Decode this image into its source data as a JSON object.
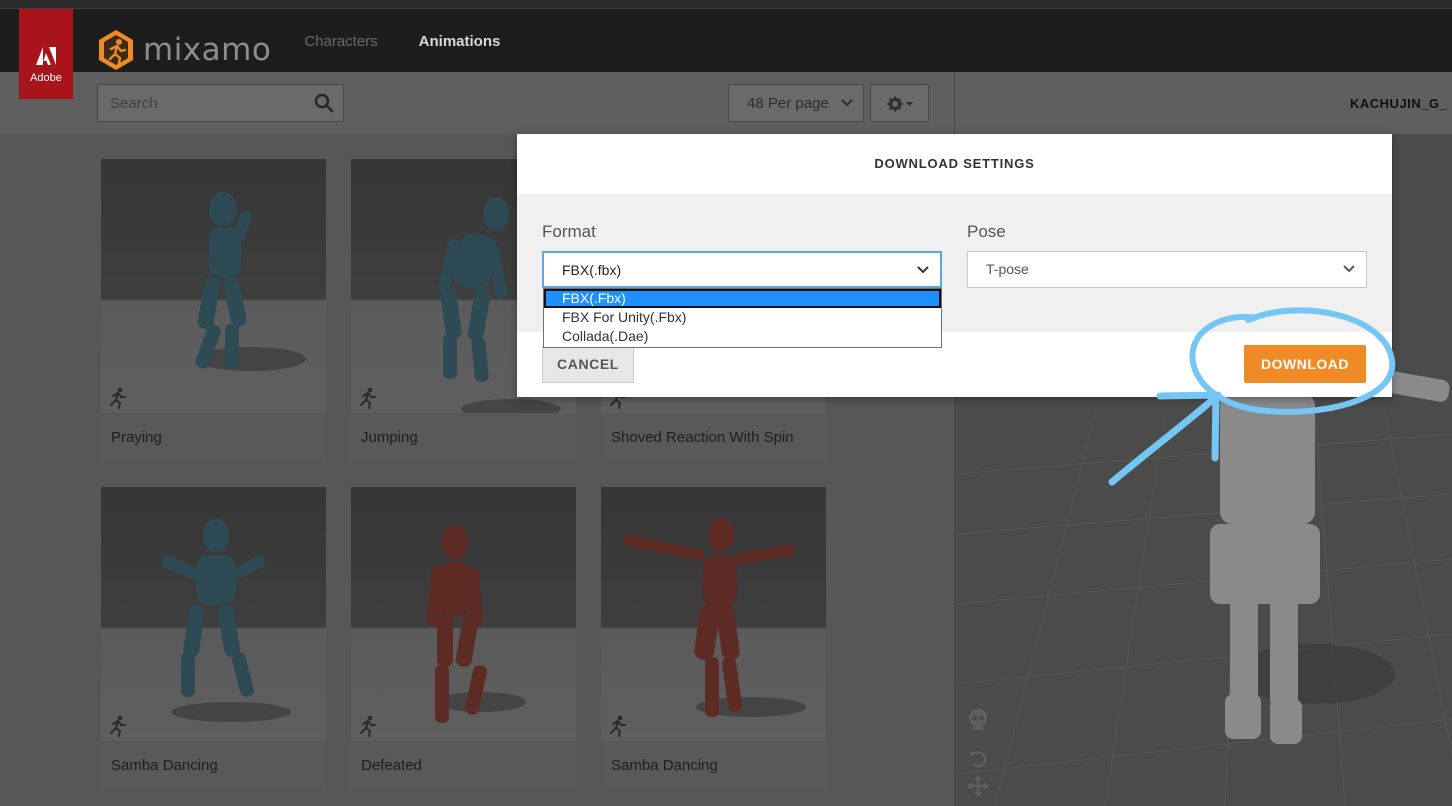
{
  "header": {
    "adobe_label": "Adobe",
    "brand": "mixamo",
    "tabs": [
      {
        "label": "Characters",
        "active": false
      },
      {
        "label": "Animations",
        "active": true
      }
    ],
    "accent_color": "#f08a24"
  },
  "toolbar": {
    "search_placeholder": "Search",
    "per_page": "48 Per page"
  },
  "viewer": {
    "title": "KACHUJIN_G_"
  },
  "cards": [
    {
      "caption": "Praying"
    },
    {
      "caption": "Jumping"
    },
    {
      "caption": "Shoved Reaction With Spin"
    },
    {
      "caption": "Samba Dancing"
    },
    {
      "caption": "Defeated"
    },
    {
      "caption": "Samba Dancing"
    }
  ],
  "modal": {
    "title": "DOWNLOAD SETTINGS",
    "format_label": "Format",
    "format_value": "FBX(.fbx)",
    "format_options": [
      "FBX(.Fbx)",
      "FBX For Unity(.Fbx)",
      "Collada(.Dae)"
    ],
    "pose_label": "Pose",
    "pose_value": "T-pose",
    "cancel_label": "CANCEL",
    "download_label": "DOWNLOAD"
  }
}
